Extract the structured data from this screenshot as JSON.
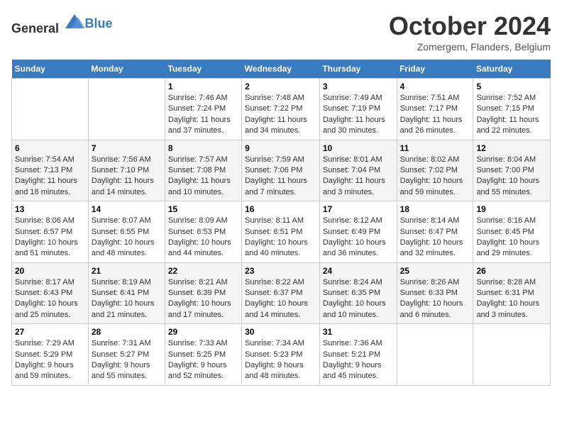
{
  "header": {
    "logo_general": "General",
    "logo_blue": "Blue",
    "month_title": "October 2024",
    "subtitle": "Zomergem, Flanders, Belgium"
  },
  "days_of_week": [
    "Sunday",
    "Monday",
    "Tuesday",
    "Wednesday",
    "Thursday",
    "Friday",
    "Saturday"
  ],
  "weeks": [
    [
      {
        "day": "",
        "sunrise": "",
        "sunset": "",
        "daylight": ""
      },
      {
        "day": "",
        "sunrise": "",
        "sunset": "",
        "daylight": ""
      },
      {
        "day": "1",
        "sunrise": "Sunrise: 7:46 AM",
        "sunset": "Sunset: 7:24 PM",
        "daylight": "Daylight: 11 hours and 37 minutes."
      },
      {
        "day": "2",
        "sunrise": "Sunrise: 7:48 AM",
        "sunset": "Sunset: 7:22 PM",
        "daylight": "Daylight: 11 hours and 34 minutes."
      },
      {
        "day": "3",
        "sunrise": "Sunrise: 7:49 AM",
        "sunset": "Sunset: 7:19 PM",
        "daylight": "Daylight: 11 hours and 30 minutes."
      },
      {
        "day": "4",
        "sunrise": "Sunrise: 7:51 AM",
        "sunset": "Sunset: 7:17 PM",
        "daylight": "Daylight: 11 hours and 26 minutes."
      },
      {
        "day": "5",
        "sunrise": "Sunrise: 7:52 AM",
        "sunset": "Sunset: 7:15 PM",
        "daylight": "Daylight: 11 hours and 22 minutes."
      }
    ],
    [
      {
        "day": "6",
        "sunrise": "Sunrise: 7:54 AM",
        "sunset": "Sunset: 7:13 PM",
        "daylight": "Daylight: 11 hours and 18 minutes."
      },
      {
        "day": "7",
        "sunrise": "Sunrise: 7:56 AM",
        "sunset": "Sunset: 7:10 PM",
        "daylight": "Daylight: 11 hours and 14 minutes."
      },
      {
        "day": "8",
        "sunrise": "Sunrise: 7:57 AM",
        "sunset": "Sunset: 7:08 PM",
        "daylight": "Daylight: 11 hours and 10 minutes."
      },
      {
        "day": "9",
        "sunrise": "Sunrise: 7:59 AM",
        "sunset": "Sunset: 7:06 PM",
        "daylight": "Daylight: 11 hours and 7 minutes."
      },
      {
        "day": "10",
        "sunrise": "Sunrise: 8:01 AM",
        "sunset": "Sunset: 7:04 PM",
        "daylight": "Daylight: 11 hours and 3 minutes."
      },
      {
        "day": "11",
        "sunrise": "Sunrise: 8:02 AM",
        "sunset": "Sunset: 7:02 PM",
        "daylight": "Daylight: 10 hours and 59 minutes."
      },
      {
        "day": "12",
        "sunrise": "Sunrise: 8:04 AM",
        "sunset": "Sunset: 7:00 PM",
        "daylight": "Daylight: 10 hours and 55 minutes."
      }
    ],
    [
      {
        "day": "13",
        "sunrise": "Sunrise: 8:06 AM",
        "sunset": "Sunset: 6:57 PM",
        "daylight": "Daylight: 10 hours and 51 minutes."
      },
      {
        "day": "14",
        "sunrise": "Sunrise: 8:07 AM",
        "sunset": "Sunset: 6:55 PM",
        "daylight": "Daylight: 10 hours and 48 minutes."
      },
      {
        "day": "15",
        "sunrise": "Sunrise: 8:09 AM",
        "sunset": "Sunset: 6:53 PM",
        "daylight": "Daylight: 10 hours and 44 minutes."
      },
      {
        "day": "16",
        "sunrise": "Sunrise: 8:11 AM",
        "sunset": "Sunset: 6:51 PM",
        "daylight": "Daylight: 10 hours and 40 minutes."
      },
      {
        "day": "17",
        "sunrise": "Sunrise: 8:12 AM",
        "sunset": "Sunset: 6:49 PM",
        "daylight": "Daylight: 10 hours and 36 minutes."
      },
      {
        "day": "18",
        "sunrise": "Sunrise: 8:14 AM",
        "sunset": "Sunset: 6:47 PM",
        "daylight": "Daylight: 10 hours and 32 minutes."
      },
      {
        "day": "19",
        "sunrise": "Sunrise: 8:16 AM",
        "sunset": "Sunset: 6:45 PM",
        "daylight": "Daylight: 10 hours and 29 minutes."
      }
    ],
    [
      {
        "day": "20",
        "sunrise": "Sunrise: 8:17 AM",
        "sunset": "Sunset: 6:43 PM",
        "daylight": "Daylight: 10 hours and 25 minutes."
      },
      {
        "day": "21",
        "sunrise": "Sunrise: 8:19 AM",
        "sunset": "Sunset: 6:41 PM",
        "daylight": "Daylight: 10 hours and 21 minutes."
      },
      {
        "day": "22",
        "sunrise": "Sunrise: 8:21 AM",
        "sunset": "Sunset: 6:39 PM",
        "daylight": "Daylight: 10 hours and 17 minutes."
      },
      {
        "day": "23",
        "sunrise": "Sunrise: 8:22 AM",
        "sunset": "Sunset: 6:37 PM",
        "daylight": "Daylight: 10 hours and 14 minutes."
      },
      {
        "day": "24",
        "sunrise": "Sunrise: 8:24 AM",
        "sunset": "Sunset: 6:35 PM",
        "daylight": "Daylight: 10 hours and 10 minutes."
      },
      {
        "day": "25",
        "sunrise": "Sunrise: 8:26 AM",
        "sunset": "Sunset: 6:33 PM",
        "daylight": "Daylight: 10 hours and 6 minutes."
      },
      {
        "day": "26",
        "sunrise": "Sunrise: 8:28 AM",
        "sunset": "Sunset: 6:31 PM",
        "daylight": "Daylight: 10 hours and 3 minutes."
      }
    ],
    [
      {
        "day": "27",
        "sunrise": "Sunrise: 7:29 AM",
        "sunset": "Sunset: 5:29 PM",
        "daylight": "Daylight: 9 hours and 59 minutes."
      },
      {
        "day": "28",
        "sunrise": "Sunrise: 7:31 AM",
        "sunset": "Sunset: 5:27 PM",
        "daylight": "Daylight: 9 hours and 55 minutes."
      },
      {
        "day": "29",
        "sunrise": "Sunrise: 7:33 AM",
        "sunset": "Sunset: 5:25 PM",
        "daylight": "Daylight: 9 hours and 52 minutes."
      },
      {
        "day": "30",
        "sunrise": "Sunrise: 7:34 AM",
        "sunset": "Sunset: 5:23 PM",
        "daylight": "Daylight: 9 hours and 48 minutes."
      },
      {
        "day": "31",
        "sunrise": "Sunrise: 7:36 AM",
        "sunset": "Sunset: 5:21 PM",
        "daylight": "Daylight: 9 hours and 45 minutes."
      },
      {
        "day": "",
        "sunrise": "",
        "sunset": "",
        "daylight": ""
      },
      {
        "day": "",
        "sunrise": "",
        "sunset": "",
        "daylight": ""
      }
    ]
  ]
}
